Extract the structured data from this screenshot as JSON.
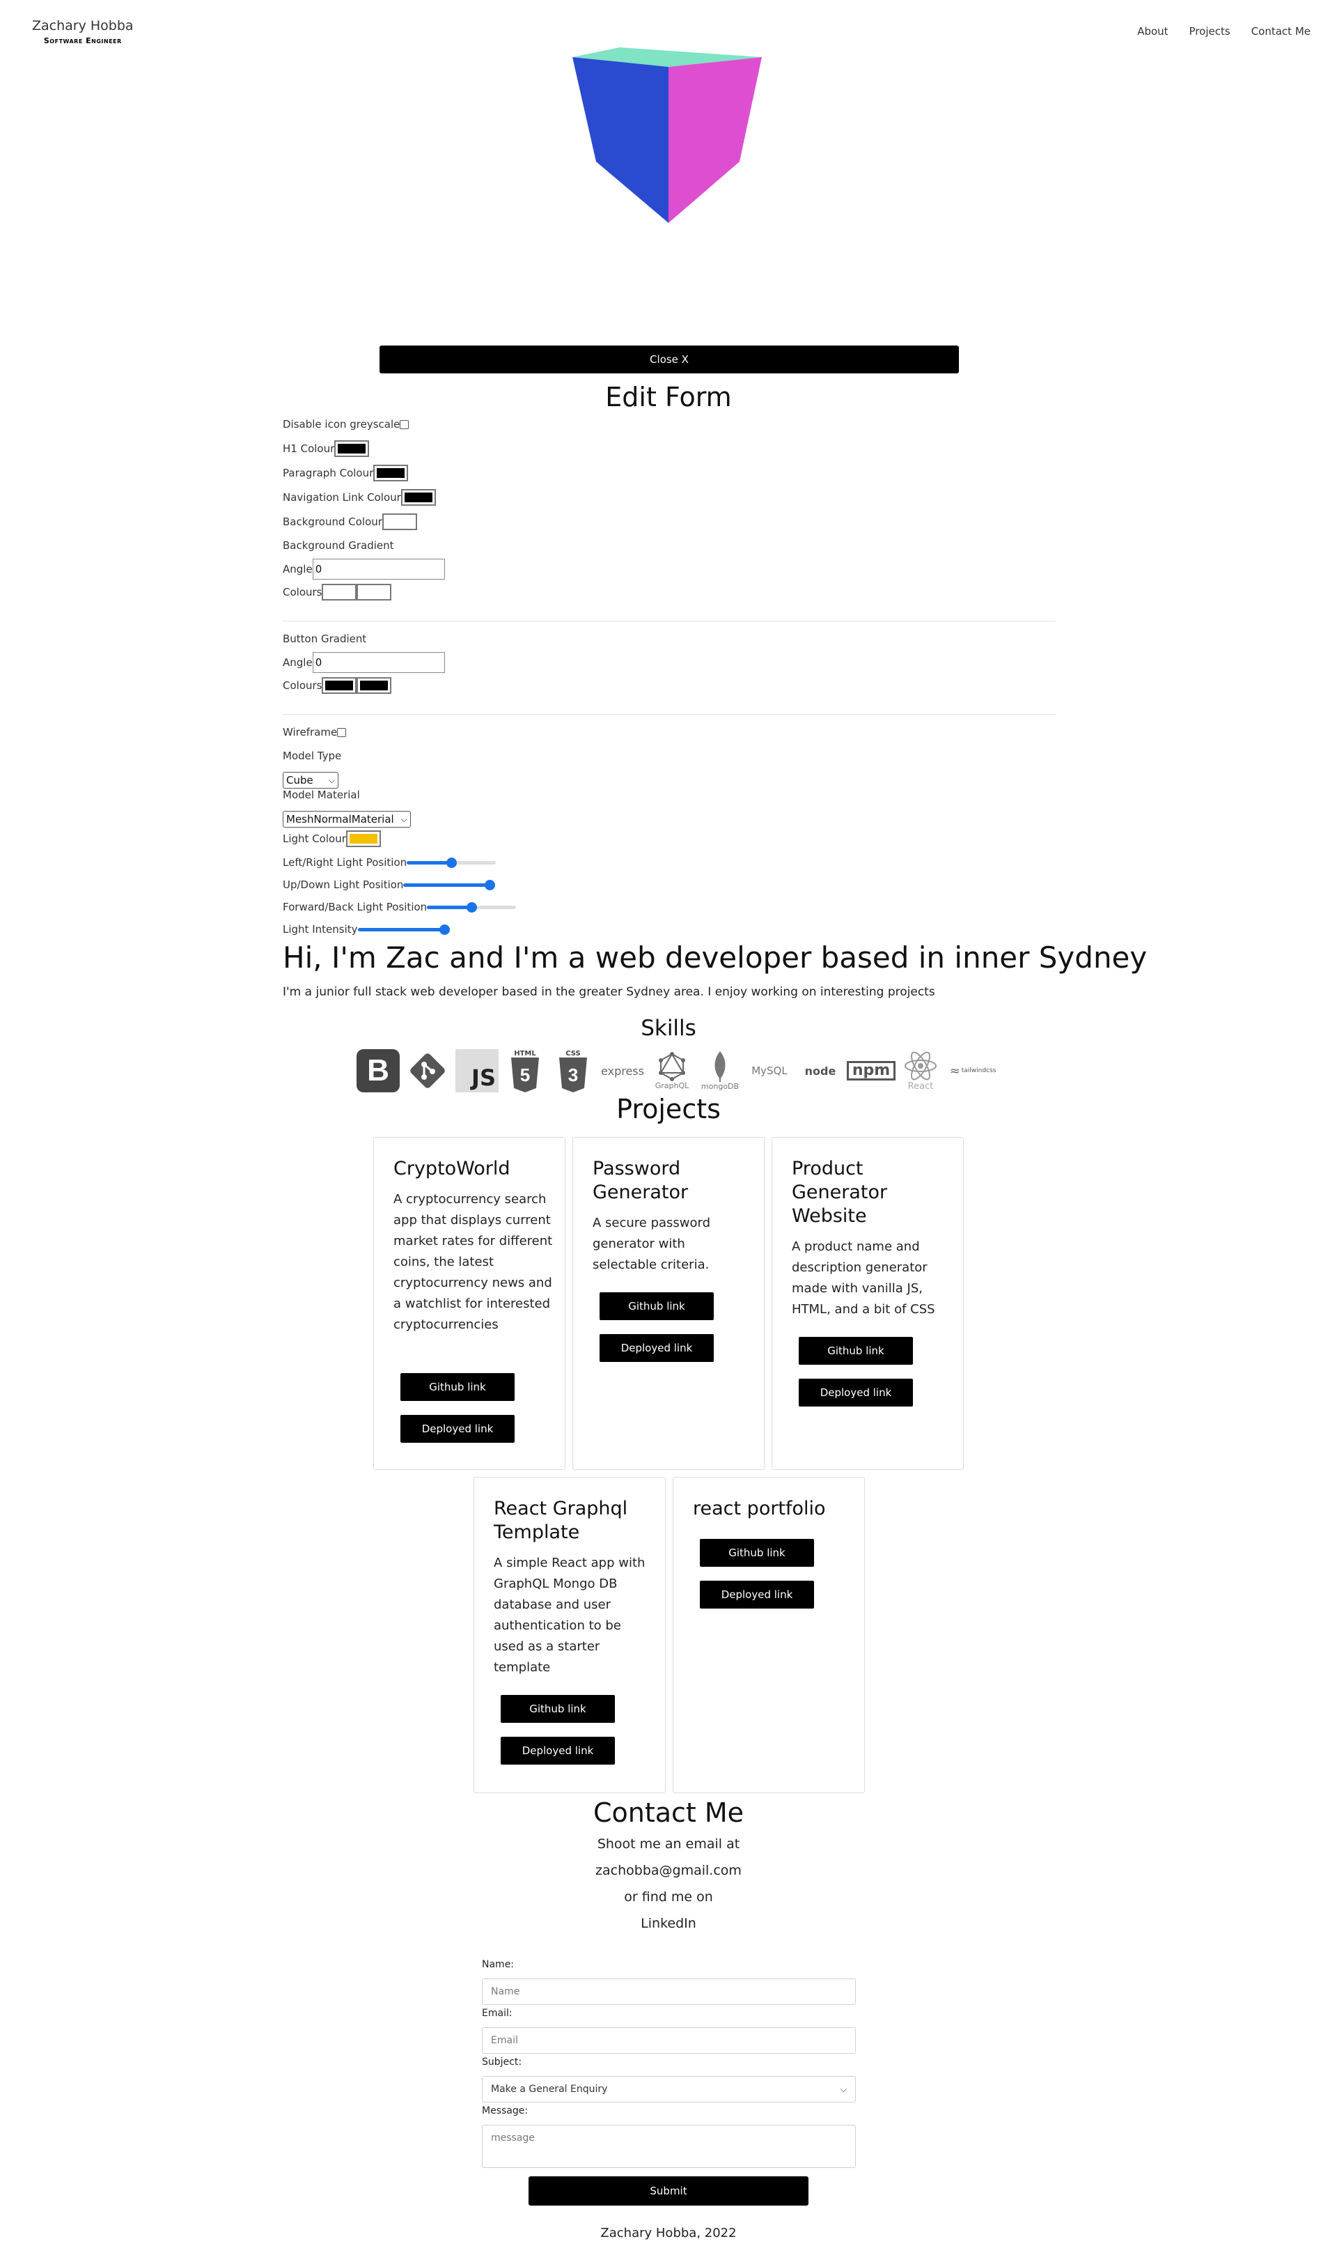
{
  "header": {
    "brand_name": "Zachary Hobba",
    "brand_subtitle": "Software Engineer",
    "nav": [
      {
        "label": "About"
      },
      {
        "label": "Projects"
      },
      {
        "label": "Contact Me"
      }
    ]
  },
  "cube": {
    "colors": {
      "top": "#7fe3c4",
      "left": "#2a4bd0",
      "right": "#dd4fd0"
    }
  },
  "edit_form": {
    "close_label": "Close X",
    "title": "Edit Form",
    "disable_greyscale_label": "Disable icon greyscale",
    "h1_colour_label": "H1 Colour",
    "h1_colour": "#000000",
    "paragraph_colour_label": "Paragraph Colour",
    "paragraph_colour": "#000000",
    "nav_link_colour_label": "Navigation Link Colour",
    "nav_link_colour": "#000000",
    "background_colour_label": "Background Colour",
    "background_colour": "#ffffff",
    "background_gradient_label": "Background Gradient",
    "bg_angle_label": "Angle",
    "bg_angle_value": "0",
    "bg_colours_label": "Colours",
    "bg_colours": [
      "#ffffff",
      "#ffffff"
    ],
    "button_gradient_label": "Button Gradient",
    "btn_angle_label": "Angle",
    "btn_angle_value": "0",
    "btn_colours_label": "Colours",
    "btn_colours": [
      "#000000",
      "#000000"
    ],
    "wireframe_label": "Wireframe",
    "model_type_label": "Model Type",
    "model_type_value": "Cube",
    "model_material_label": "Model Material",
    "model_material_value": "MeshNormalMaterial",
    "light_colour_label": "Light Colour",
    "light_colour": "#f5c000",
    "lr_light_label": "Left/Right Light Position",
    "lr_light_value": 0.5,
    "ud_light_label": "Up/Down Light Position",
    "ud_light_value": 1.0,
    "fb_light_label": "Forward/Back Light Position",
    "fb_light_value": 0.5,
    "intensity_label": "Light Intensity",
    "intensity_value": 1.0
  },
  "hero": {
    "title": "Hi, I'm Zac and I'm a web developer based in inner Sydney",
    "text": "I'm a junior full stack web developer based in the greater Sydney area. I enjoy working on interesting projects"
  },
  "skills": {
    "title": "Skills",
    "icons": [
      {
        "name": "bootstrap-icon",
        "label": "B"
      },
      {
        "name": "git-icon",
        "label": ""
      },
      {
        "name": "javascript-icon",
        "label": "JS"
      },
      {
        "name": "html5-icon",
        "label": "HTML"
      },
      {
        "name": "css3-icon",
        "label": "CSS"
      },
      {
        "name": "express-icon",
        "label": "express"
      },
      {
        "name": "graphql-icon",
        "label": "GraphQL"
      },
      {
        "name": "mongodb-icon",
        "label": "mongoDB"
      },
      {
        "name": "mysql-icon",
        "label": "MySQL"
      },
      {
        "name": "nodejs-icon",
        "label": "node"
      },
      {
        "name": "npm-icon",
        "label": "npm"
      },
      {
        "name": "react-icon",
        "label": "React"
      },
      {
        "name": "tailwindcss-icon",
        "label": "tailwindcss"
      }
    ]
  },
  "projects": {
    "title": "Projects",
    "github_label": "Github link",
    "deployed_label": "Deployed link",
    "items": [
      {
        "title": "CryptoWorld",
        "description": "A cryptocurrency search app that displays current market rates for different coins, the latest cryptocurrency news and a watchlist for interested cryptocurrencies"
      },
      {
        "title": "Password Generator",
        "description": "A secure password generator with selectable criteria."
      },
      {
        "title": "Product Generator Website",
        "description": "A product name and description generator made with vanilla JS, HTML, and a bit of CSS"
      },
      {
        "title": "React Graphql Template",
        "description": "A simple React app with GraphQL Mongo DB database and user authentication to be used as a starter template"
      },
      {
        "title": "react portfolio",
        "description": ""
      }
    ]
  },
  "contact": {
    "title": "Contact Me",
    "line1": "Shoot me an email at",
    "email": "zachobba@gmail.com",
    "line3": "or find me on",
    "linkedin": "LinkedIn",
    "name_label": "Name:",
    "name_placeholder": "Name",
    "email_label": "Email:",
    "email_placeholder": "Email",
    "subject_label": "Subject:",
    "subject_value": "Make a General Enquiry",
    "message_label": "Message:",
    "message_placeholder": "message",
    "submit_label": "Submit"
  },
  "footer": {
    "text": "Zachary Hobba, 2022"
  }
}
